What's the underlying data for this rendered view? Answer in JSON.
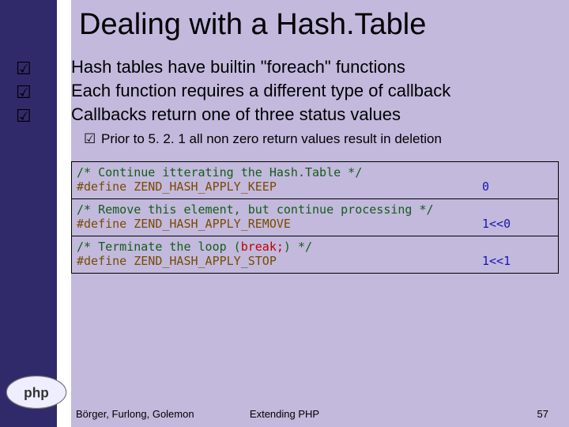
{
  "title": "Dealing with a Hash.Table",
  "bullets": [
    "Hash tables have builtin \"foreach\" functions",
    "Each function requires a different type of callback",
    "Callbacks return one of three status values"
  ],
  "sub_bullet": "Prior to 5. 2. 1 all non zero return values result in deletion",
  "checkmark": "☑",
  "code": {
    "cells": [
      {
        "comment": "/* Continue itterating the Hash.Table */",
        "define": "#define ZEND_HASH_APPLY_KEEP",
        "value": "0"
      },
      {
        "comment": "/* Remove this element, but continue processing */",
        "define": "#define ZEND_HASH_APPLY_REMOVE",
        "value": "1<<0"
      },
      {
        "comment_pre": "/* Terminate the loop (",
        "comment_break": "break;",
        "comment_post": ") */",
        "define": "#define ZEND_HASH_APPLY_STOP",
        "value": "1<<1"
      }
    ]
  },
  "footer": {
    "authors": "Börger, Furlong, Golemon",
    "center": "Extending PHP",
    "page": "57"
  }
}
